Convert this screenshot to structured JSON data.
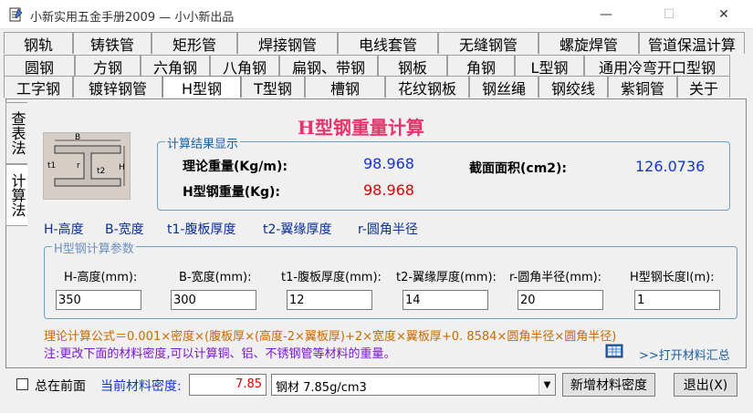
{
  "window": {
    "title": "小新实用五金手册2009 — 小小新出品",
    "min": "—",
    "max": "☐",
    "close": "✕"
  },
  "tabs": {
    "row1": [
      "钢轨",
      "铸铁管",
      "矩形管",
      "焊接钢管",
      "电线套管",
      "无缝钢管",
      "螺旋焊管",
      "管道保温计算"
    ],
    "row2": [
      "圆钢",
      "方钢",
      "六角钢",
      "八角钢",
      "扁钢、带钢",
      "钢板",
      "角钢",
      "L型钢",
      "通用冷弯开口型钢"
    ],
    "row3": [
      "工字钢",
      "镀锌钢管",
      "H型钢",
      "T型钢",
      "槽钢",
      "花纹钢板",
      "钢丝绳",
      "钢绞线",
      "紫铜管",
      "关于"
    ],
    "active": "H型钢"
  },
  "side_tabs": [
    "查表法",
    "计算法"
  ],
  "page_title": "H型钢重量计算",
  "diagram_labels": {
    "b": "B",
    "h": "H",
    "t1": "t1",
    "t2": "t2",
    "r": "r"
  },
  "results": {
    "group_title": "计算结果显示",
    "theory_weight_label": "理论重量(Kg/m):",
    "theory_weight_value": "98.968",
    "area_label": "截面面积(cm2):",
    "area_value": "126.0736",
    "total_weight_label": "H型钢重量(Kg):",
    "total_weight_value": "98.968"
  },
  "legend": [
    "H-高度",
    "B-宽度",
    "t1-腹板厚度",
    "t2-翼缘厚度",
    "r-圆角半径"
  ],
  "params": {
    "group_title": "H型钢计算参数",
    "labels": [
      "H-高度(mm):",
      "B-宽度(mm):",
      "t1-腹板厚度(mm):",
      "t2-翼缘厚度(mm):",
      "r-圆角半径(mm):",
      "H型钢长度l(m):"
    ],
    "values": [
      "350",
      "300",
      "12",
      "14",
      "20",
      "1"
    ]
  },
  "formula": "理论计算公式＝0.001×密度×(腹板厚×(高度-2×翼板厚)+2×宽度×翼板厚+0. 8584×圆角半径×圆角半径)",
  "note": "注:更改下面的材料密度,可以计算铜、铝、不锈钢管等材料的重量。",
  "summary_link": ">>打开材料汇总",
  "bottom": {
    "always_on_top": "总在前面",
    "density_label": "当前材料密度:",
    "density_value": "7.85",
    "material_selected": "钢材 7.85g/cm3",
    "add_density_button": "新增材料密度",
    "exit_button": "退出(X)"
  },
  "colors": {
    "title_pink": "#e8336d",
    "value_blue": "#1433d6",
    "value_red": "#e00000",
    "formula_orange": "#c86a00",
    "note_purple": "#7b16c8"
  }
}
